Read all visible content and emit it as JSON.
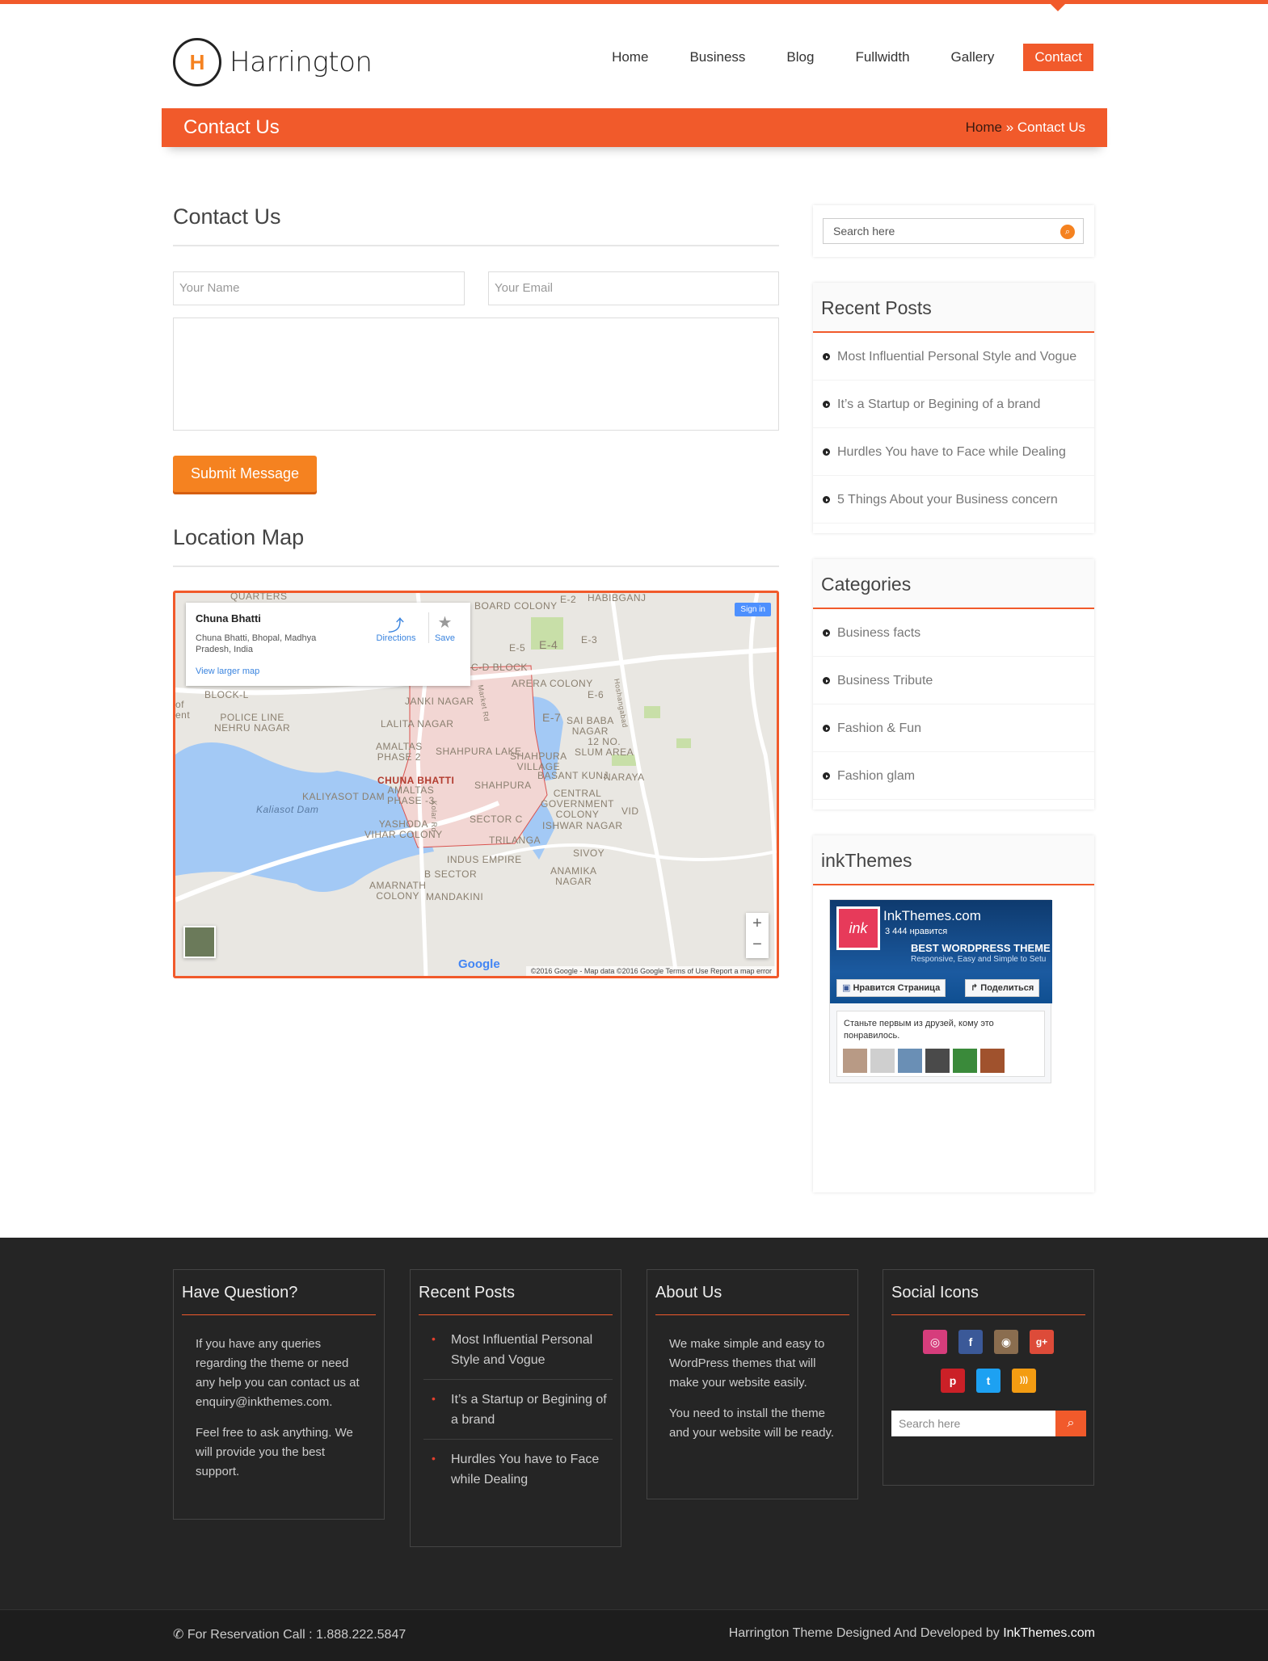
{
  "brand": {
    "logo_letter": "H",
    "name": "Harrington",
    "accent": "#f15a2b"
  },
  "nav": [
    {
      "label": "Home"
    },
    {
      "label": "Business"
    },
    {
      "label": "Blog"
    },
    {
      "label": "Fullwidth"
    },
    {
      "label": "Gallery"
    },
    {
      "label": "Contact",
      "active": true
    }
  ],
  "banner": {
    "title": "Contact Us",
    "crumb_home": "Home",
    "crumb_sep": " » ",
    "crumb_current": "Contact Us"
  },
  "contact": {
    "heading": "Contact Us",
    "name_placeholder": "Your Name",
    "email_placeholder": "Your Email",
    "submit_label": "Submit Message"
  },
  "location": {
    "heading": "Location Map",
    "card_title": "Chuna Bhatti",
    "card_address": "Chuna Bhatti, Bhopal, Madhya Pradesh, India",
    "card_link": "View larger map",
    "directions_label": "Directions",
    "save_label": "Save",
    "signin_label": "Sign in",
    "zoom_in": "+",
    "zoom_out": "−",
    "google_logo": "Google",
    "footer_text": "©2016 Google - Map data ©2016 Google   Terms of Use   Report a map error",
    "labels": {
      "board_colony": "BOARD COLONY",
      "cd_block": "C-D BLOCK",
      "arera_colony": "ARERA COLONY",
      "e5": "E-5",
      "e4": "E-4",
      "e3": "E-3",
      "e2": "E-2",
      "e6": "E-6",
      "e7": "E-7",
      "block_l": "BLOCK-L",
      "police_line": "POLICE LINE\nNEHRU NAGAR",
      "janki_nagar": "JANKI NAGAR",
      "lalita_nagar": "LALITA NAGAR",
      "amaltas2": "AMALTAS\nPHASE 2",
      "shahpura_lake": "SHAHPURA LAKE",
      "sai_baba": "SAI BABA\nNAGAR",
      "slum_area": "12 NO.\nSLUM AREA",
      "shahpura_village": "SHAHPURA\nVILLAGE",
      "basant_kunj": "BASANT KUNJ",
      "chuna_bhatti": "CHUNA BHATTI",
      "amaltas3": "AMALTAS\nPHASE -3",
      "kaliyasot_dam": "KALIYASOT DAM",
      "shahpura": "SHAHPURA",
      "central_gov": "CENTRAL\nGOVERNMENT\nCOLONY",
      "sector_c": "SECTOR C",
      "yashoda": "YASHODA\nVIHAR COLONY",
      "ishwar_nagar": "ISHWAR NAGAR",
      "trilanga": "TRILANGA",
      "sivoy": "SIVOY",
      "indus_empire": "INDUS EMPIRE",
      "anamika": "ANAMIKA\nNAGAR",
      "b_sector": "B SECTOR",
      "amarnath": "AMARNATH\nCOLONY",
      "mandakini": "MANDAKINI",
      "quarters": "QUARTERS",
      "kaliasot_dam2": "Kaliasot Dam",
      "narayan": "NARAYA",
      "vid": "VID",
      "habibganj": "HABIBGANJ",
      "of_ent": "of\nent",
      "kolar_rd": "Kolar Rd",
      "market_rd": "Market Rd",
      "hoshangabad": "Hoshangabad"
    }
  },
  "sidebar": {
    "search_placeholder": "Search here",
    "recent_posts": {
      "title": "Recent Posts",
      "items": [
        "Most Influential Personal Style and Vogue",
        "It’s a Startup or Begining of a brand",
        "Hurdles You have to Face while Dealing",
        "5 Things About your Business concern"
      ]
    },
    "categories": {
      "title": "Categories",
      "items": [
        "Business facts",
        "Business Tribute",
        "Fashion & Fun",
        "Fashion glam"
      ]
    },
    "inkthemes": {
      "title": "inkThemes",
      "page_name": "InkThemes.com",
      "likes": "3 444 нравится",
      "logo_text": "ink",
      "cover_title": "BEST WORDPRESS THEME",
      "cover_sub": "Responsive, Easy and Simple to Setu",
      "like_btn": "Нравится Страница",
      "share_btn": "Поделиться",
      "friends_text": "Станьте первым из друзей, кому это понравилось."
    }
  },
  "footer": {
    "question": {
      "title": "Have Question?",
      "p1": "If you have any queries regarding the theme or need any help you can contact us at enquiry@inkthemes.com.",
      "p2": "Feel free to ask anything. We will provide you the best support."
    },
    "recent": {
      "title": "Recent Posts",
      "items": [
        "Most Influential Personal Style and Vogue",
        "It’s a Startup or Begining of a brand",
        "Hurdles You have to Face while Dealing"
      ]
    },
    "about": {
      "title": "About Us",
      "p1": "We make simple and easy to WordPress themes that will make your website easily.",
      "p2": "You need to install the theme and your website will be ready."
    },
    "social": {
      "title": "Social Icons",
      "icons": [
        {
          "name": "dribbble-icon",
          "glyph": "◎",
          "color": "#d63d7c"
        },
        {
          "name": "facebook-icon",
          "glyph": "f",
          "color": "#3b5998"
        },
        {
          "name": "instagram-icon",
          "glyph": "◉",
          "color": "#8a6d4f"
        },
        {
          "name": "google-plus-icon",
          "glyph": "g+",
          "color": "#dd4b39"
        },
        {
          "name": "pinterest-icon",
          "glyph": "p",
          "color": "#cb2027"
        },
        {
          "name": "twitter-icon",
          "glyph": "t",
          "color": "#1da1f2"
        },
        {
          "name": "rss-icon",
          "glyph": ")))",
          "color": "#f39c12"
        }
      ],
      "search_placeholder": "Search here"
    }
  },
  "bottom": {
    "call": "For Reservation Call : 1.888.222.5847",
    "credit": "Harrington Theme Designed And Developed by ",
    "credit_brand": "InkThemes.com"
  }
}
